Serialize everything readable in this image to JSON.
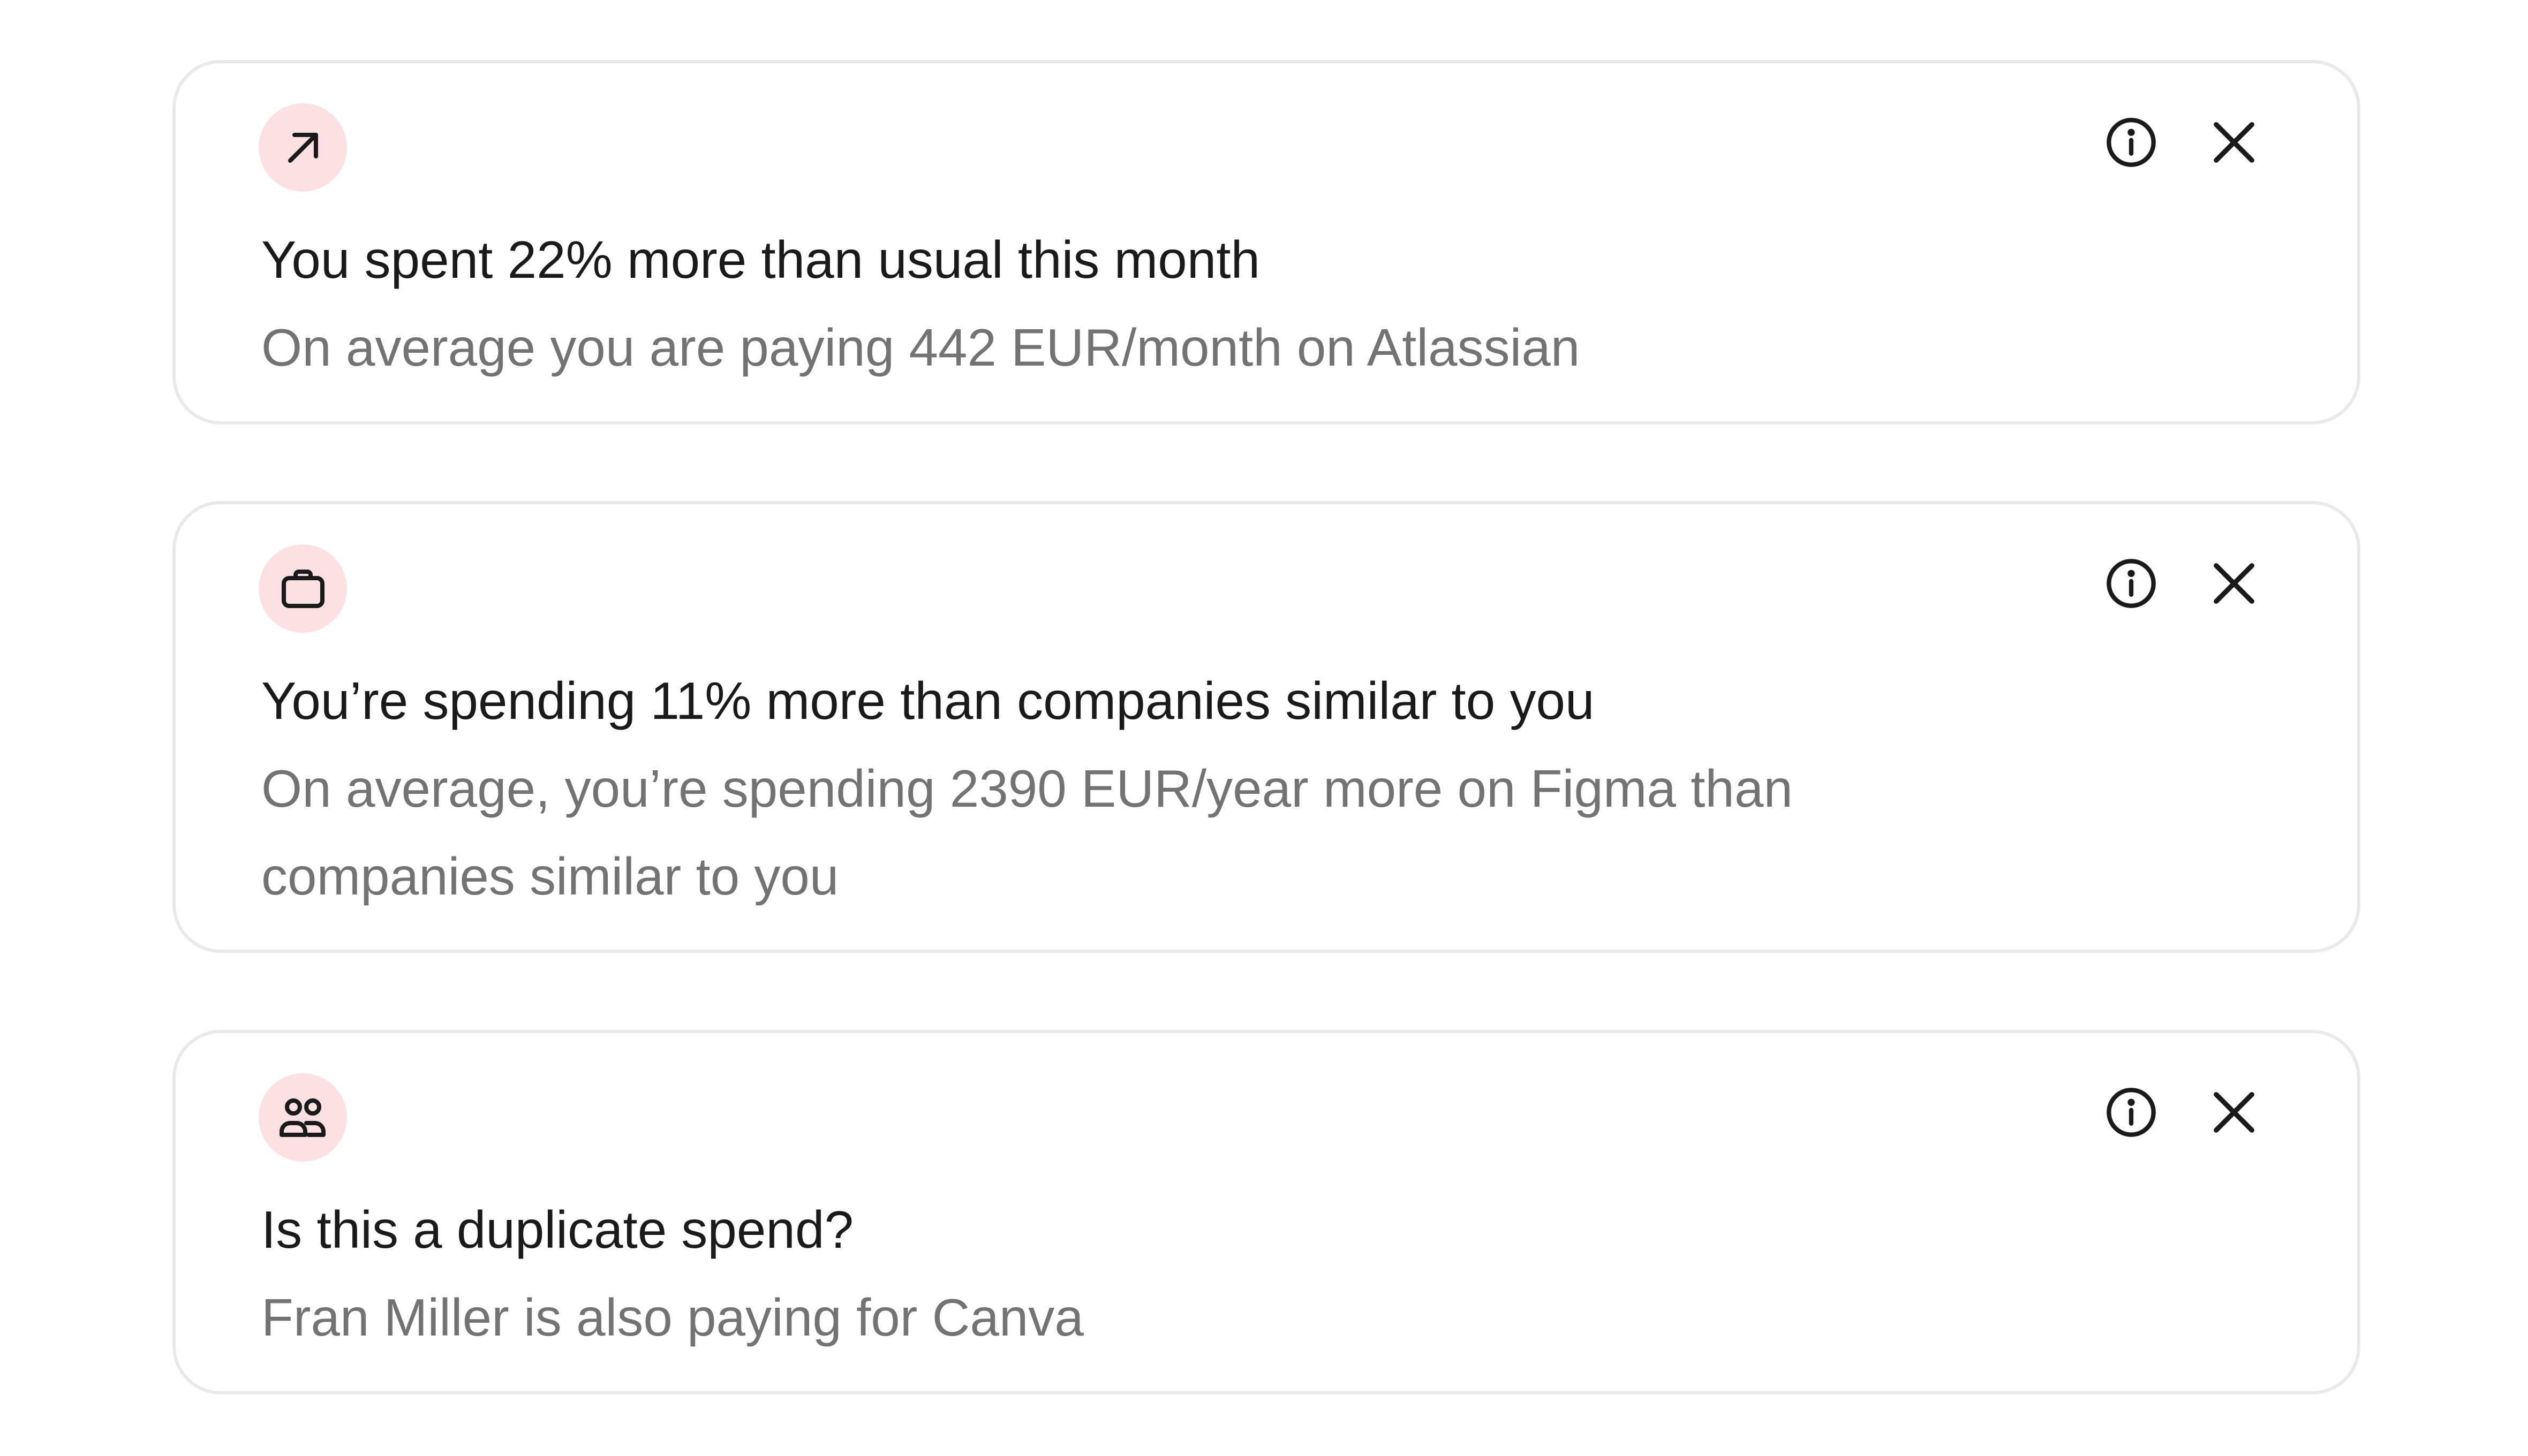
{
  "colors": {
    "badge_background": "#fde0e4",
    "title_text": "#1a1a1a",
    "description_text": "#737373",
    "card_border": "#e9e9e9"
  },
  "cards": [
    {
      "icon": "arrow-up-right-icon",
      "title": "You spent 22% more than usual this month",
      "description": "On average you are paying 442 EUR/month on Atlassian",
      "info_icon": "info-icon",
      "close_icon": "close-icon"
    },
    {
      "icon": "briefcase-icon",
      "title": "You’re spending 11% more than companies similar to you",
      "description": "On average, you’re spending 2390 EUR/year more on Figma than companies similar to you",
      "info_icon": "info-icon",
      "close_icon": "close-icon"
    },
    {
      "icon": "users-icon",
      "title": "Is this a duplicate spend?",
      "description": "Fran Miller is also paying for Canva",
      "info_icon": "info-icon",
      "close_icon": "close-icon"
    }
  ]
}
